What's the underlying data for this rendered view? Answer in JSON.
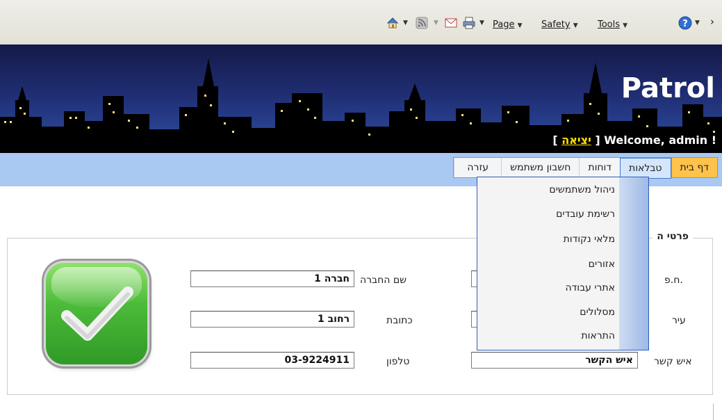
{
  "command_bar": {
    "page_label": "Page",
    "safety_label": "Safety",
    "tools_label": "Tools",
    "chevron": "›"
  },
  "header": {
    "logo": "Patrol",
    "welcome": "Welcome, admin !",
    "logout_open": "[",
    "logout_label": "יציאה",
    "logout_close": "]"
  },
  "menu": {
    "items": [
      "דף בית",
      "טבלאות",
      "דוחות",
      "חשבון משתמש",
      "עזרה"
    ],
    "active_index": 0,
    "open_index": 1
  },
  "dropdown": {
    "items": [
      "ניהול משתמשים",
      "רשימת עובדים",
      "מלאי נקודות",
      "אזורים",
      "אתרי עבודה",
      "מסלולים",
      "התראות"
    ]
  },
  "details": {
    "legend": "פרטי ה",
    "fields": {
      "hp_label": "ח.פ.",
      "city_label": "עיר",
      "contact_label": "איש קשר",
      "contact_value": "איש הקשר",
      "company_label": "שם החברה",
      "company_value": "חברה 1",
      "address_label": "כתובת",
      "address_value": "רחוב 1",
      "phone_label": "טלפון",
      "phone_value": "03-9224911"
    }
  },
  "colors": {
    "menu_bg": "#a9c9f2",
    "active_tab": "#ffc24a",
    "banner_top": "#141a48",
    "welcome_text": "#ffffff",
    "logout_text": "#ffe000",
    "check_green": "#4dbb3a"
  },
  "icons": [
    "home-icon",
    "feeds-icon",
    "read-mail-icon",
    "print-icon",
    "help-icon",
    "check-icon"
  ]
}
